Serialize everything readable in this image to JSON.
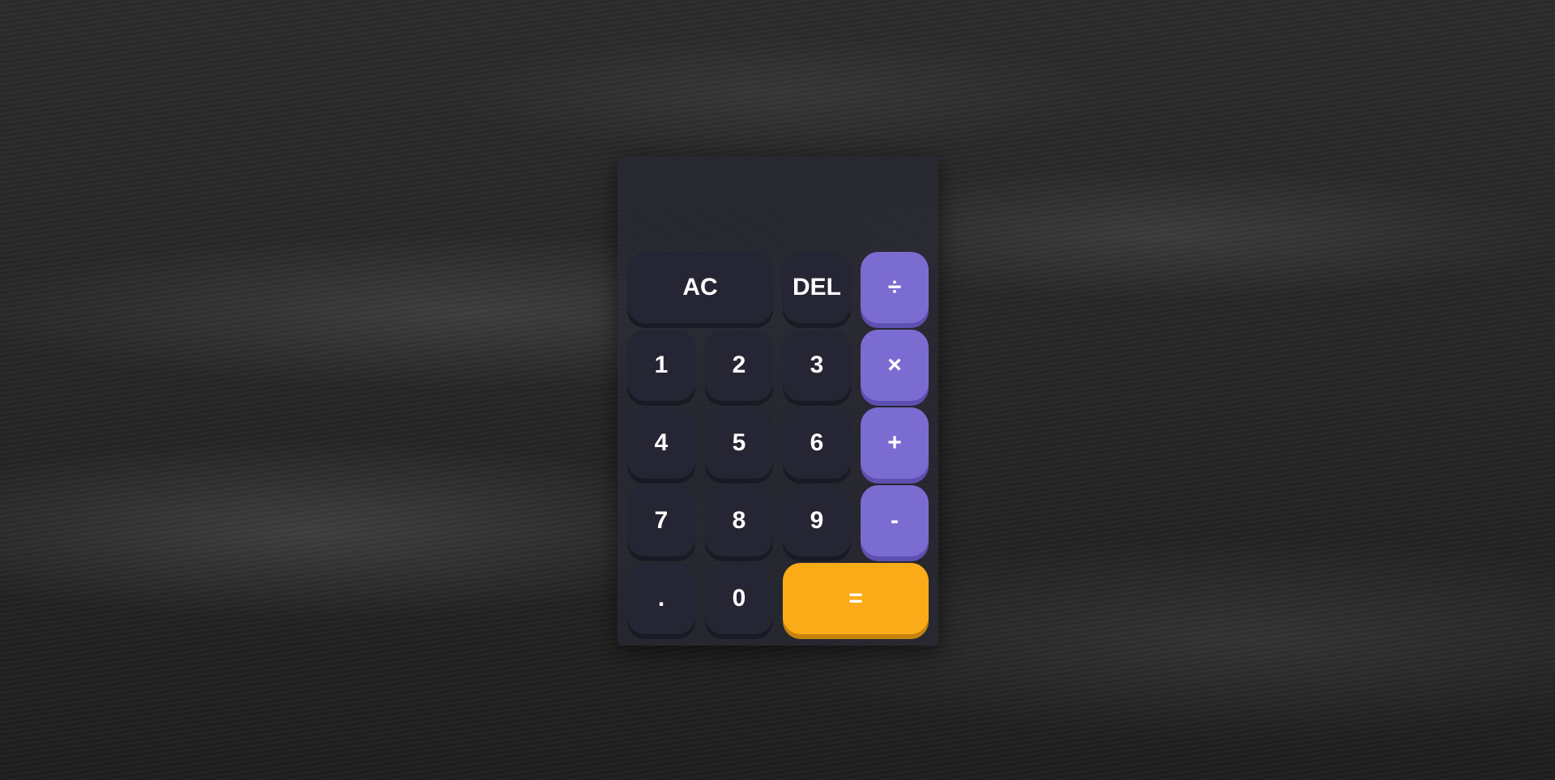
{
  "calculator": {
    "display": {
      "previous_operand": "",
      "current_operand": ""
    },
    "keys": {
      "ac": "AC",
      "del": "DEL",
      "divide": "÷",
      "one": "1",
      "two": "2",
      "three": "3",
      "multiply": "×",
      "four": "4",
      "five": "5",
      "six": "6",
      "plus": "+",
      "seven": "7",
      "eight": "8",
      "nine": "9",
      "minus": "-",
      "decimal": ".",
      "zero": "0",
      "equals": "="
    }
  },
  "colors": {
    "number_key": "#252533",
    "operator_key": "#7b6cd1",
    "equals_key": "#fbab18",
    "panel": "#28283a",
    "background": "#2a2a2a"
  }
}
